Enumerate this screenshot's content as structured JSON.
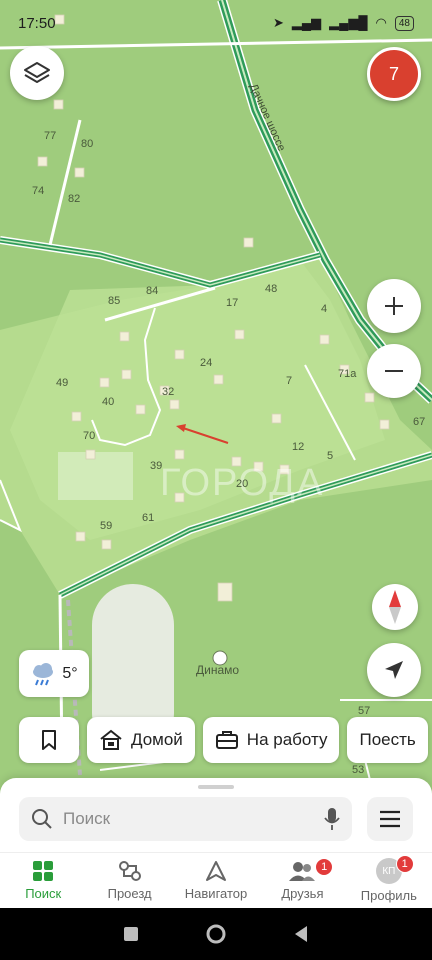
{
  "status_bar": {
    "time": "17:50",
    "battery": "48"
  },
  "map": {
    "street_name": "Дачное шоссе",
    "place_name": "Динамо",
    "watermark": "ГОРОДА",
    "house_numbers": [
      "77",
      "80",
      "74",
      "82",
      "85",
      "84",
      "17",
      "48",
      "4",
      "24",
      "7",
      "71а",
      "49",
      "40",
      "32",
      "70",
      "67",
      "12",
      "5",
      "39",
      "20",
      "59",
      "61",
      "57",
      "53"
    ]
  },
  "notifications_count": "7",
  "weather": {
    "temperature": "5°",
    "icon": "rain-cloud-icon"
  },
  "chips": [
    {
      "icon": "bookmark-icon",
      "label": ""
    },
    {
      "icon": "home-icon",
      "label": "Домой"
    },
    {
      "icon": "briefcase-icon",
      "label": "На работу"
    },
    {
      "icon": "",
      "label": "Поесть"
    }
  ],
  "search": {
    "placeholder": "Поиск"
  },
  "tabs": [
    {
      "label": "Поиск",
      "icon": "search-grid-icon",
      "active": true
    },
    {
      "label": "Проезд",
      "icon": "route-icon"
    },
    {
      "label": "Навигатор",
      "icon": "navigator-icon"
    },
    {
      "label": "Друзья",
      "icon": "friends-icon",
      "badge": "1"
    },
    {
      "label": "Профиль",
      "icon": "avatar-icon",
      "badge": "1",
      "avatar_text": "КП"
    }
  ],
  "colors": {
    "accent": "#2a9d3a",
    "badge": "#d9402f",
    "map_green": "#9fcc7d",
    "park_green": "#b6dc8f",
    "road": "#2f9b5a"
  }
}
